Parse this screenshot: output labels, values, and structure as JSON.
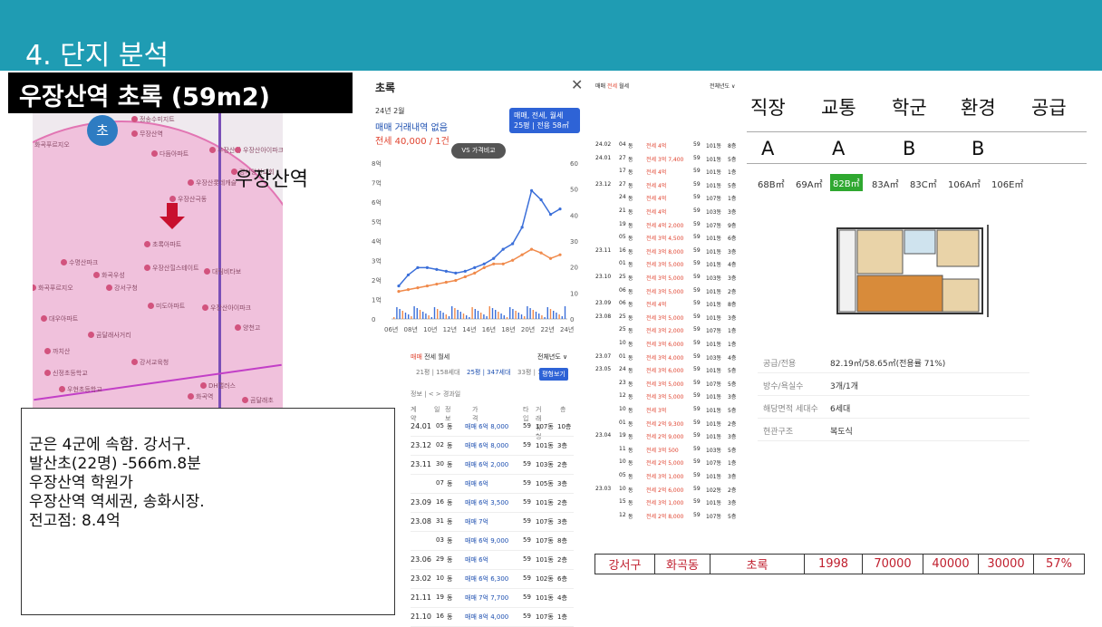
{
  "slide": {
    "title": "4. 단지 분석"
  },
  "complex": {
    "title": "우장산역 초록 (59m2)"
  },
  "map": {
    "station_label": "우장산역",
    "school_badge": "초",
    "labels": [
      "정송수미지트",
      "무장산역",
      "화곡푸르지오",
      "다듬아파트",
      "우장산역",
      "우장산아이파크",
      "강서양천교회",
      "우장산롯데캐슬",
      "우장산극동",
      "초록아파트",
      "수명산파크",
      "화곡우성",
      "우장산힐스테이트",
      "대림비타보",
      "화곡푸르지오",
      "강서구청",
      "미도아파트",
      "우장산아이파크",
      "대우아파트",
      "양천고",
      "곰달래사거리",
      "까치산",
      "강서교육청",
      "신정초등학교",
      "우현초등학교",
      "DH캘러스",
      "화곡역",
      "곰달래초"
    ]
  },
  "notes": {
    "lines": [
      "군은 4군에 속함. 강서구.",
      "발산초(22명) -566m.8분",
      "우장산역 학원가",
      "우장산역 역세권, 송화시장.",
      "전고점: 8.4억"
    ]
  },
  "price_panel": {
    "title": "초록",
    "close_icon": "close-icon",
    "date": "24년 2월",
    "line1": "매매 거래내역 없음",
    "line2": "전세 40,000 / 1건",
    "box_line1": "매매, 전세, 월세",
    "box_line2": "25평 | 전용 58㎡",
    "vs_button": "VS 가격비교"
  },
  "chart_data": {
    "type": "line",
    "title": "",
    "x_ticks": [
      "06년",
      "08년",
      "10년",
      "12년",
      "14년",
      "16년",
      "18년",
      "20년",
      "22년",
      "24년"
    ],
    "y_left_ticks": [
      "8억",
      "7억",
      "6억",
      "5억",
      "4억",
      "3억",
      "2억",
      "1억",
      "0"
    ],
    "y_right_ticks": [
      "60",
      "50",
      "40",
      "30",
      "20",
      "10",
      "0"
    ],
    "ylim": [
      0,
      8.5
    ],
    "series": [
      {
        "color": "#3b6fd9",
        "values": [
          1.8,
          2.4,
          2.8,
          2.8,
          2.7,
          2.6,
          2.5,
          2.6,
          2.8,
          3.0,
          3.3,
          3.8,
          4.1,
          5.0,
          7.0,
          6.5,
          5.7,
          6.0
        ]
      },
      {
        "color": "#f08a4b",
        "values": [
          1.5,
          1.6,
          1.7,
          1.8,
          1.9,
          2.0,
          2.1,
          2.3,
          2.5,
          2.8,
          3.0,
          3.0,
          3.2,
          3.5,
          3.8,
          3.6,
          3.3,
          3.5
        ]
      }
    ]
  },
  "tx_a": {
    "tabs": [
      "매매",
      "전세",
      "월세"
    ],
    "period": "전체년도 ∨",
    "types": [
      "21평 | 158세대",
      "25평 | 347세대",
      "33평 | 120세대"
    ],
    "button": "평형보기",
    "sub": "정보 | < > 경과일",
    "header": [
      "계약",
      "일",
      "정보",
      "가격",
      "타입",
      "거래유형",
      "층"
    ],
    "rows": [
      [
        "24.01",
        "05",
        "동",
        "매매 6억 8,000",
        "59",
        "107동",
        "10층"
      ],
      [
        "23.12",
        "02",
        "동",
        "매매 6억 8,000",
        "59",
        "101동",
        "3층"
      ],
      [
        "23.11",
        "30",
        "동",
        "매매 6억 2,000",
        "59",
        "103동",
        "2층"
      ],
      [
        "",
        "07",
        "동",
        "매매 6억",
        "59",
        "105동",
        "3층"
      ],
      [
        "23.09",
        "16",
        "동",
        "매매 6억 3,500",
        "59",
        "101동",
        "2층"
      ],
      [
        "23.08",
        "31",
        "동",
        "매매 7억",
        "59",
        "107동",
        "3층"
      ],
      [
        "",
        "03",
        "동",
        "매매 6억 9,000",
        "59",
        "107동",
        "8층"
      ],
      [
        "23.06",
        "29",
        "동",
        "매매 6억",
        "59",
        "101동",
        "2층"
      ],
      [
        "23.02",
        "10",
        "동",
        "매매 6억 6,300",
        "59",
        "102동",
        "6층"
      ],
      [
        "21.11",
        "19",
        "동",
        "매매 7억 7,700",
        "59",
        "101동",
        "4층"
      ],
      [
        "21.10",
        "16",
        "동",
        "매매 8억 4,000",
        "59",
        "107동",
        "1층"
      ]
    ]
  },
  "tx_b": {
    "tabs": [
      "매매",
      "전세",
      "월세"
    ],
    "period": "전체년도 ∨",
    "rows": [
      [
        "24.02",
        "04",
        "동",
        "전세 4억",
        "59",
        "101동",
        "8층"
      ],
      [
        "24.01",
        "27",
        "동",
        "전세 3억 7,400",
        "59",
        "101동",
        "5층"
      ],
      [
        "",
        "17",
        "동",
        "전세 4억",
        "59",
        "101동",
        "1층"
      ],
      [
        "23.12",
        "27",
        "동",
        "전세 4억",
        "59",
        "101동",
        "5층"
      ],
      [
        "",
        "24",
        "동",
        "전세 4억",
        "59",
        "107동",
        "1층"
      ],
      [
        "",
        "21",
        "동",
        "전세 4억",
        "59",
        "103동",
        "3층"
      ],
      [
        "",
        "19",
        "동",
        "전세 4억 2,000",
        "59",
        "107동",
        "9층"
      ],
      [
        "",
        "05",
        "동",
        "전세 3억 4,500",
        "59",
        "101동",
        "6층"
      ],
      [
        "23.11",
        "16",
        "동",
        "전세 3억 8,000",
        "59",
        "101동",
        "3층"
      ],
      [
        "",
        "01",
        "동",
        "전세 3억 5,000",
        "59",
        "101동",
        "4층"
      ],
      [
        "23.10",
        "25",
        "동",
        "전세 3억 5,000",
        "59",
        "103동",
        "3층"
      ],
      [
        "",
        "06",
        "동",
        "전세 3억 5,000",
        "59",
        "101동",
        "2층"
      ],
      [
        "23.09",
        "06",
        "동",
        "전세 4억",
        "59",
        "101동",
        "8층"
      ],
      [
        "23.08",
        "25",
        "동",
        "전세 3억 5,000",
        "59",
        "101동",
        "3층"
      ],
      [
        "",
        "25",
        "동",
        "전세 3억 2,000",
        "59",
        "107동",
        "1층"
      ],
      [
        "",
        "10",
        "동",
        "전세 3억 6,000",
        "59",
        "101동",
        "1층"
      ],
      [
        "23.07",
        "01",
        "동",
        "전세 3억 4,000",
        "59",
        "103동",
        "4층"
      ],
      [
        "23.05",
        "24",
        "동",
        "전세 3억 6,000",
        "59",
        "101동",
        "5층"
      ],
      [
        "",
        "23",
        "동",
        "전세 3억 5,000",
        "59",
        "107동",
        "5층"
      ],
      [
        "",
        "12",
        "동",
        "전세 3억 5,000",
        "59",
        "101동",
        "3층"
      ],
      [
        "",
        "10",
        "동",
        "전세 3억",
        "59",
        "101동",
        "5층"
      ],
      [
        "",
        "01",
        "동",
        "전세 2억 9,300",
        "59",
        "101동",
        "2층"
      ],
      [
        "23.04",
        "19",
        "동",
        "전세 2억 9,000",
        "59",
        "101동",
        "3층"
      ],
      [
        "",
        "11",
        "동",
        "전세 3억 500",
        "59",
        "103동",
        "5층"
      ],
      [
        "",
        "10",
        "동",
        "전세 2억 5,000",
        "59",
        "107동",
        "1층"
      ],
      [
        "",
        "05",
        "동",
        "전세 3억 1,000",
        "59",
        "101동",
        "3층"
      ],
      [
        "23.03",
        "10",
        "동",
        "전세 2억 6,000",
        "59",
        "102동",
        "2층"
      ],
      [
        "",
        "15",
        "동",
        "전세 3억 1,000",
        "59",
        "101동",
        "3층"
      ],
      [
        "",
        "12",
        "동",
        "전세 2억 8,000",
        "59",
        "107동",
        "5층"
      ]
    ]
  },
  "grades": {
    "headers": [
      "직장",
      "교통",
      "학군",
      "환경",
      "공급"
    ],
    "values": [
      "A",
      "A",
      "B",
      "B",
      ""
    ]
  },
  "area_tabs": [
    "68B㎡",
    "69A㎡",
    "82B㎡",
    "83A㎡",
    "83C㎡",
    "106A㎡",
    "106E㎡"
  ],
  "details": [
    {
      "k": "공급/전용",
      "v": "82.19㎡/58.65㎡(전용률 71%)"
    },
    {
      "k": "방수/욕실수",
      "v": "3개/1개"
    },
    {
      "k": "해당면적 세대수",
      "v": "6세대"
    },
    {
      "k": "현관구조",
      "v": "복도식"
    }
  ],
  "summary": [
    "강서구",
    "화곡동",
    "초록",
    "1998",
    "70000",
    "40000",
    "30000",
    "57%"
  ]
}
